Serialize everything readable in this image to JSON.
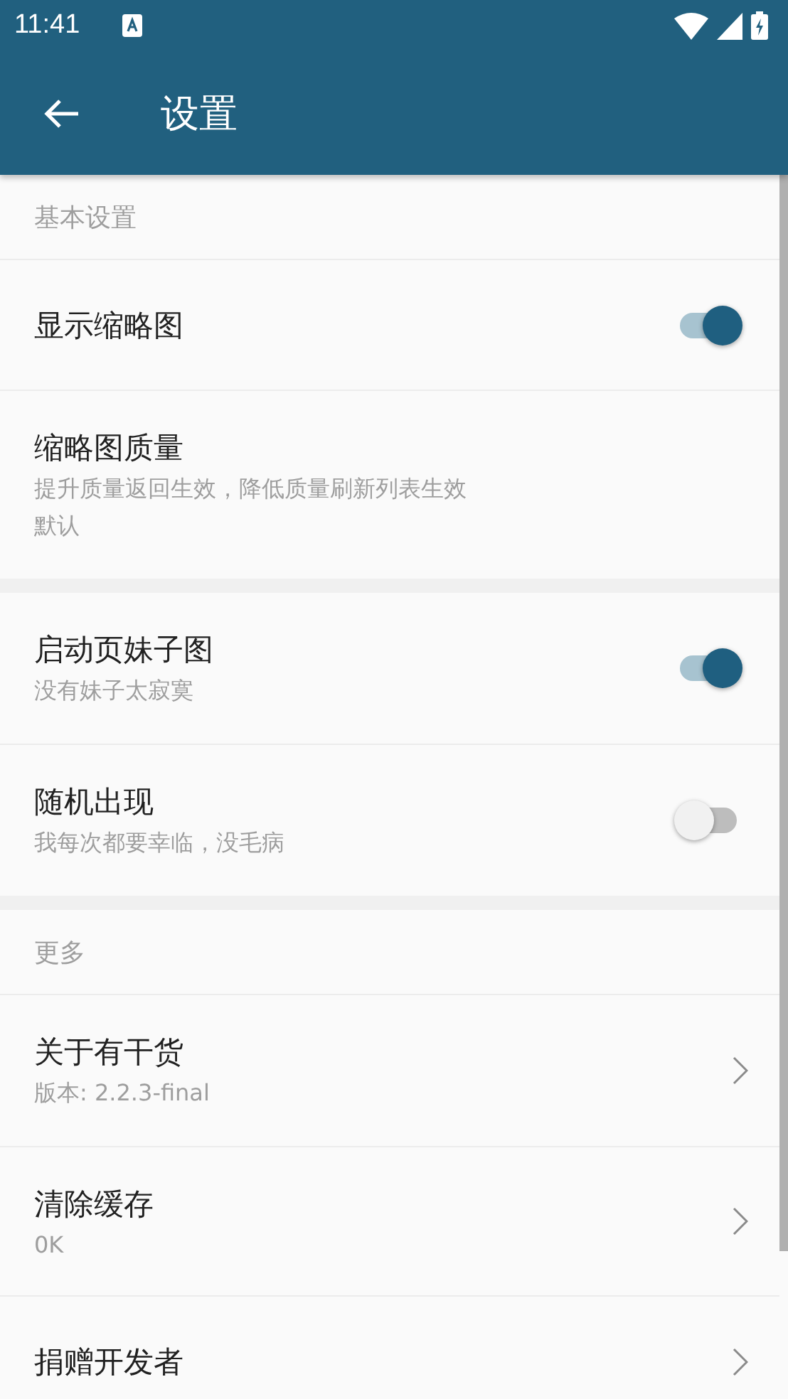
{
  "status_bar": {
    "time": "11:41"
  },
  "app_bar": {
    "title": "设置"
  },
  "sections": [
    {
      "header": "基本设置",
      "items": [
        {
          "kind": "toggle",
          "title": "显示缩略图",
          "on": true
        },
        {
          "kind": "text",
          "title": "缩略图质量",
          "summary": "提升质量返回生效，降低质量刷新列表生效",
          "value": "默认"
        }
      ]
    },
    {
      "items": [
        {
          "kind": "toggle",
          "title": "启动页妹子图",
          "summary": "没有妹子太寂寞",
          "on": true
        },
        {
          "kind": "toggle",
          "title": "随机出现",
          "summary": "我每次都要幸临，没毛病",
          "on": false
        }
      ]
    },
    {
      "header": "更多",
      "items": [
        {
          "kind": "link",
          "title": "关于有干货",
          "summary": "版本: 2.2.3-final"
        },
        {
          "kind": "link",
          "title": "清除缓存",
          "summary": "0K"
        },
        {
          "kind": "link",
          "title": "捐赠开发者"
        }
      ]
    }
  ]
}
